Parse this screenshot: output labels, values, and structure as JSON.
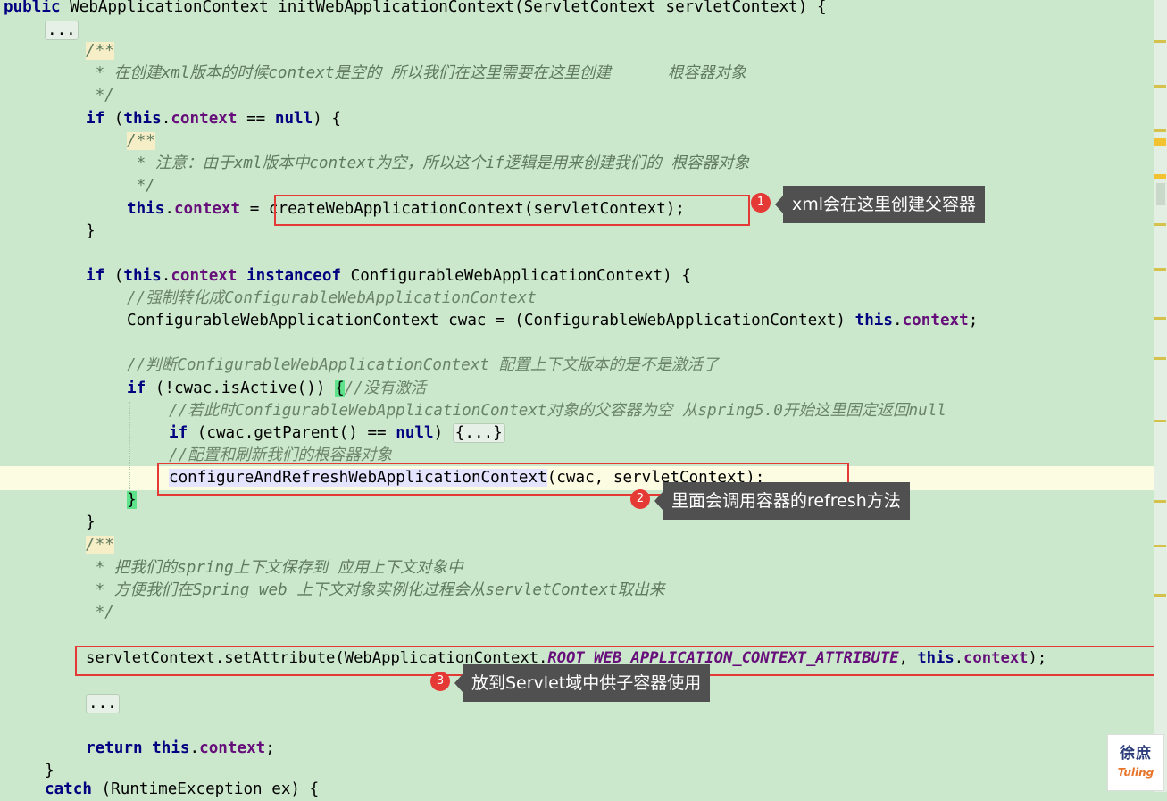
{
  "code": {
    "l0": {
      "kw_public": "public",
      "sig": " WebApplicationContext initWebApplicationContext(ServletContext servletContext) {"
    },
    "l1": {
      "fold": "..."
    },
    "l2": {
      "doc": "/**"
    },
    "l3": {
      "doc": " * 在创建xml版本的时候context是空的 所以我们在这里需要在这里创建      根容器对象"
    },
    "l4": {
      "doc": " */"
    },
    "l5": {
      "kw_if": "if",
      "p1": " (",
      "kw_this": "this",
      "dot": ".",
      "fld": "context",
      "p2": " == ",
      "kw_null": "null",
      "p3": ") {"
    },
    "l6": {
      "doc": "/**"
    },
    "l7": {
      "doc": " * 注意：由于xml版本中context为空，所以这个if逻辑是用来创建我们的 根容器对象"
    },
    "l8": {
      "doc": " */"
    },
    "l9": {
      "kw_this": "this",
      "dot": ".",
      "fld": "context",
      "eq": " = ",
      "call": "createWebApplicationContext(servletContext);"
    },
    "l10": {
      "brace": "}"
    },
    "l12": {
      "kw_if": "if",
      "p1": " (",
      "kw_this": "this",
      "dot": ".",
      "fld": "context",
      "sp": " ",
      "kw_inst": "instanceof",
      "rest": " ConfigurableWebApplicationContext) {"
    },
    "l13": {
      "cmt": "//强制转化成ConfigurableWebApplicationContext"
    },
    "l14": {
      "decl": "ConfigurableWebApplicationContext cwac = (ConfigurableWebApplicationContext) ",
      "kw_this": "this",
      "dot": ".",
      "fld": "context",
      "semi": ";"
    },
    "l16": {
      "cmt": "//判断ConfigurableWebApplicationContext 配置上下文版本的是不是激活了"
    },
    "l17": {
      "kw_if": "if",
      "p1": " (!cwac.isActive()) ",
      "brace": "{",
      "cmt": "//没有激活"
    },
    "l18": {
      "cmt": "//若此时ConfigurableWebApplicationContext对象的父容器为空 从spring5.0开始这里固定返回null"
    },
    "l19": {
      "kw_if": "if",
      "p1": " (cwac.getParent() == ",
      "kw_null": "null",
      "p2": ") ",
      "fold": "{...}"
    },
    "l20": {
      "cmt": "//配置和刷新我们的根容器对象"
    },
    "l21": {
      "method": "configureAndRefreshWebApplicationContext",
      "args": "(cwac, servletContext);"
    },
    "l22": {
      "brace": "}"
    },
    "l23": {
      "brace": "}"
    },
    "l24": {
      "doc": "/**"
    },
    "l25": {
      "doc": " * 把我们的spring上下文保存到 应用上下文对象中"
    },
    "l26": {
      "doc": " * 方便我们在Spring web 上下文对象实例化过程会从servletContext取出来"
    },
    "l27": {
      "doc": " */"
    },
    "l29": {
      "pre": "servletContext.setAttribute(WebApplicationContext.",
      "const": "ROOT_WEB_APPLICATION_CONTEXT_ATTRIBUTE",
      "mid": ", ",
      "kw_this": "this",
      "dot": ".",
      "fld": "context",
      "end": ");"
    },
    "l30": {
      "fold": "..."
    },
    "l32": {
      "kw_return": "return",
      "sp": " ",
      "kw_this": "this",
      "dot": ".",
      "fld": "context",
      "semi": ";"
    },
    "l33": {
      "brace": "}"
    },
    "l34": {
      "kw_catch": "catch",
      "rest": " (RuntimeException ex) {"
    }
  },
  "annotations": [
    {
      "number": "1",
      "text": "xml会在这里创建父容器"
    },
    {
      "number": "2",
      "text": "里面会调用容器的refresh方法"
    },
    {
      "number": "3",
      "text": "放到Servlet域中供子容器使用"
    }
  ],
  "watermark": {
    "line1": "徐庶",
    "line2": "Tuling"
  },
  "colors": {
    "background": "#cce8cc",
    "keyword": "#000080",
    "field": "#660e7a",
    "comment": "#6a846a",
    "highlight_box": "#e53935",
    "callout_bg": "#505050"
  }
}
